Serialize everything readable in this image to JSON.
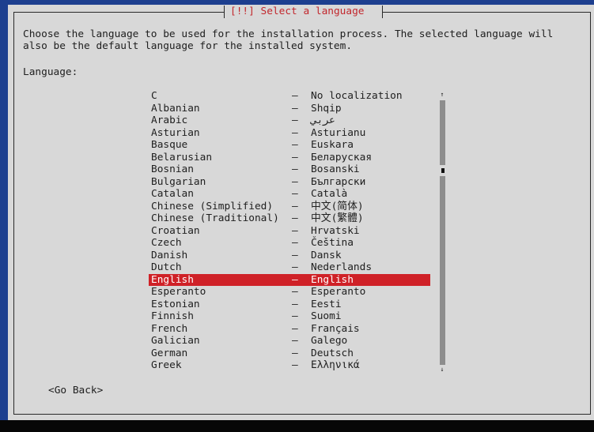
{
  "dialog": {
    "title": "[!!] Select a language",
    "description": "Choose the language to be used for the installation process. The selected language will\nalso be the default language for the installed system.",
    "list_label": "Language:",
    "go_back_label": "<Go Back>"
  },
  "languages": [
    {
      "name": "C",
      "native": "No localization"
    },
    {
      "name": "Albanian",
      "native": "Shqip"
    },
    {
      "name": "Arabic",
      "native": "عربي"
    },
    {
      "name": "Asturian",
      "native": "Asturianu"
    },
    {
      "name": "Basque",
      "native": "Euskara"
    },
    {
      "name": "Belarusian",
      "native": "Беларуская"
    },
    {
      "name": "Bosnian",
      "native": "Bosanski"
    },
    {
      "name": "Bulgarian",
      "native": "Български"
    },
    {
      "name": "Catalan",
      "native": "Català"
    },
    {
      "name": "Chinese (Simplified)",
      "native": "中文(简体)"
    },
    {
      "name": "Chinese (Traditional)",
      "native": "中文(繁體)"
    },
    {
      "name": "Croatian",
      "native": "Hrvatski"
    },
    {
      "name": "Czech",
      "native": "Čeština"
    },
    {
      "name": "Danish",
      "native": "Dansk"
    },
    {
      "name": "Dutch",
      "native": "Nederlands"
    },
    {
      "name": "English",
      "native": "English",
      "selected": true
    },
    {
      "name": "Esperanto",
      "native": "Esperanto"
    },
    {
      "name": "Estonian",
      "native": "Eesti"
    },
    {
      "name": "Finnish",
      "native": "Suomi"
    },
    {
      "name": "French",
      "native": "Français"
    },
    {
      "name": "Galician",
      "native": "Galego"
    },
    {
      "name": "German",
      "native": "Deutsch"
    },
    {
      "name": "Greek",
      "native": "Ελληνικά"
    }
  ],
  "separator": "–",
  "scrollbar": {
    "up_icon": "↑",
    "down_icon": "↓"
  },
  "colors": {
    "background": "#1d3f8f",
    "dialog": "#d8d8d8",
    "selection": "#cf2127",
    "title": "#c2272d"
  }
}
